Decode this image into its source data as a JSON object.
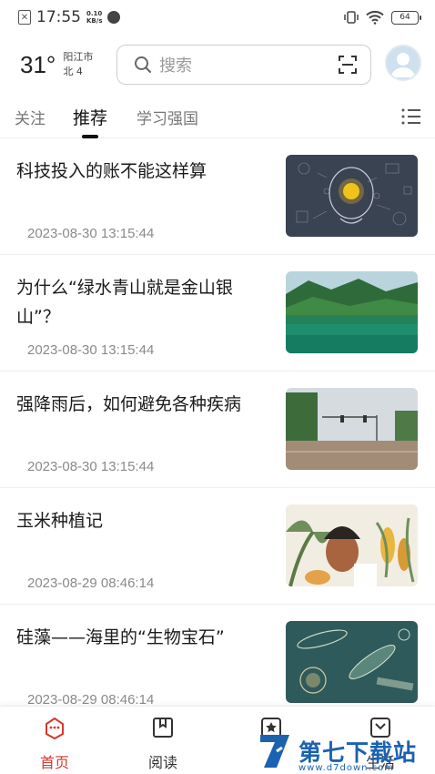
{
  "status_bar": {
    "time": "17:55",
    "speed_value": "0.10",
    "speed_unit": "KB/s",
    "battery": "64"
  },
  "header": {
    "temperature": "31°",
    "city": "阳江市",
    "wind": "北 4",
    "search_placeholder": "搜索"
  },
  "tabs": [
    {
      "label": "关注",
      "active": false
    },
    {
      "label": "推荐",
      "active": true
    },
    {
      "label": "学习强国",
      "active": false
    }
  ],
  "articles": [
    {
      "title": "科技投入的账不能这样算",
      "date": "2023-08-30 13:15:44",
      "image": "tech-brain-image"
    },
    {
      "title": "为什么“绿水青山就是金山银山”？",
      "date": "2023-08-30 13:15:44",
      "image": "green-lake-mountains-image"
    },
    {
      "title": "强降雨后，如何避免各种疾病",
      "date": "2023-08-30 13:15:44",
      "image": "flooded-street-image"
    },
    {
      "title": "玉米种植记",
      "date": "2023-08-29 08:46:14",
      "image": "corn-illustration-image"
    },
    {
      "title": "硅藻——海里的“生物宝石”",
      "date": "2023-08-29 08:46:14",
      "image": "diatoms-image"
    }
  ],
  "bottom_nav": [
    {
      "label": "首页",
      "icon": "home-icon",
      "active": true
    },
    {
      "label": "阅读",
      "icon": "book-icon",
      "active": false
    },
    {
      "label": "",
      "icon": "star-icon",
      "active": false
    },
    {
      "label": "生活",
      "icon": "life-icon",
      "active": false
    }
  ],
  "watermark": {
    "text": "第七下载站",
    "url": "www.d7down.com"
  },
  "colors": {
    "accent": "#d8372b",
    "watermark": "#1b62b0"
  }
}
